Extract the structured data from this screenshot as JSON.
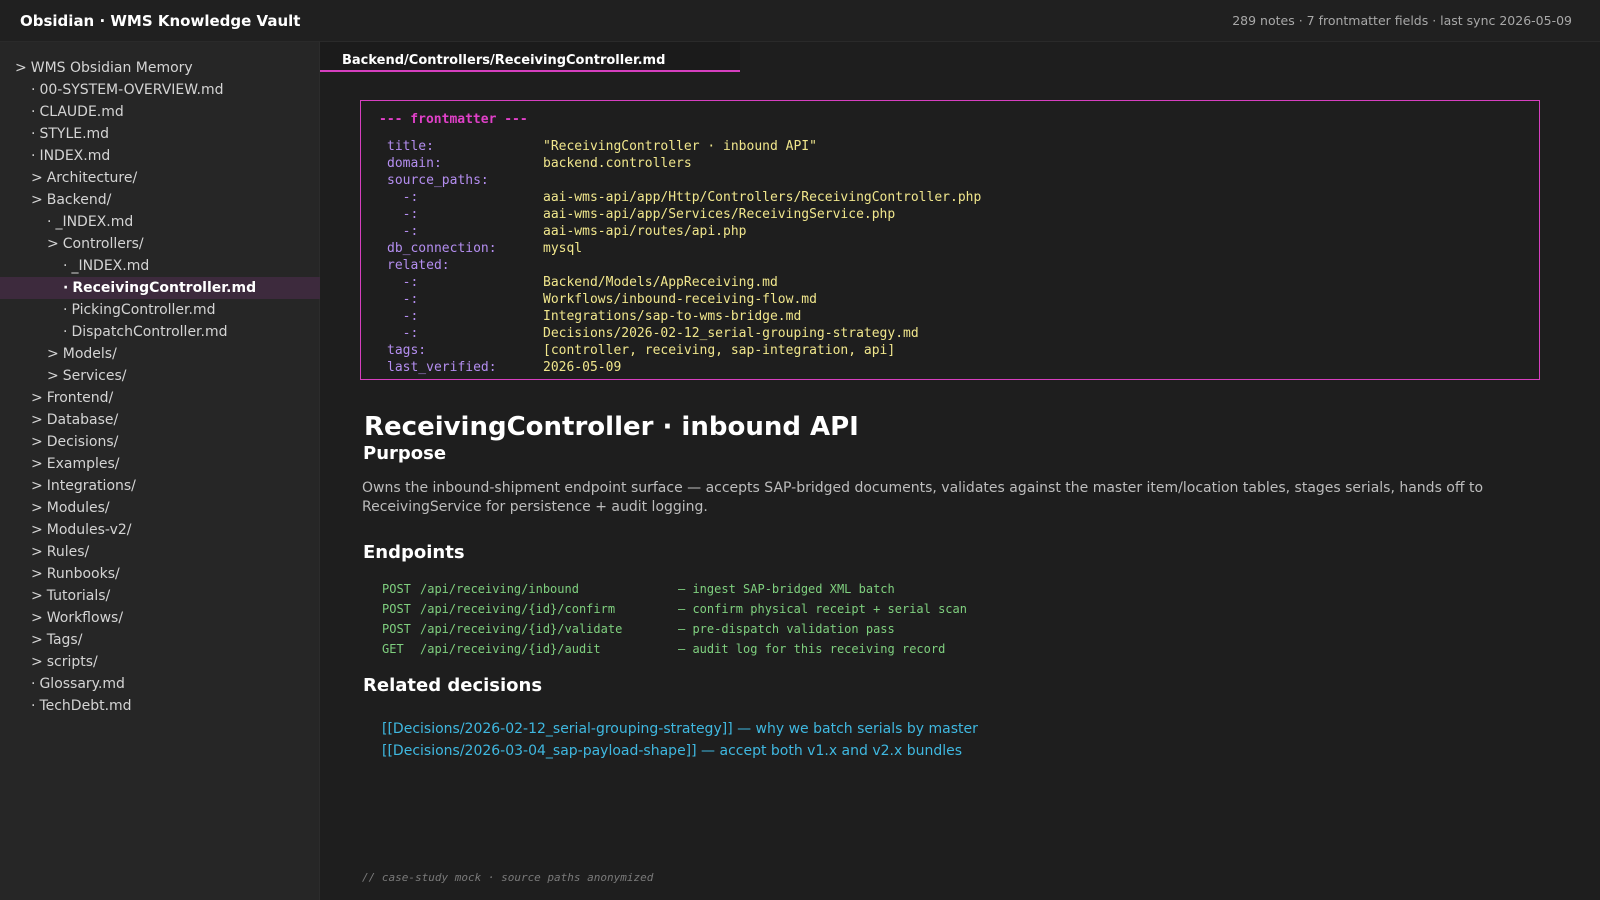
{
  "app": {
    "title": "Obsidian · WMS Knowledge Vault",
    "stats": "289 notes · 7 frontmatter fields · last sync 2026-05-09"
  },
  "sidebar": {
    "items": [
      {
        "label": "WMS Obsidian Memory",
        "marker": ">",
        "depth": 0,
        "type": "folder"
      },
      {
        "label": "00-SYSTEM-OVERVIEW.md",
        "marker": "·",
        "depth": 1,
        "type": "file"
      },
      {
        "label": "CLAUDE.md",
        "marker": "·",
        "depth": 1,
        "type": "file"
      },
      {
        "label": "STYLE.md",
        "marker": "·",
        "depth": 1,
        "type": "file"
      },
      {
        "label": "INDEX.md",
        "marker": "·",
        "depth": 1,
        "type": "file"
      },
      {
        "label": "Architecture/",
        "marker": ">",
        "depth": 1,
        "type": "folder"
      },
      {
        "label": "Backend/",
        "marker": ">",
        "depth": 1,
        "type": "folder"
      },
      {
        "label": "_INDEX.md",
        "marker": "·",
        "depth": 2,
        "type": "file"
      },
      {
        "label": "Controllers/",
        "marker": ">",
        "depth": 2,
        "type": "folder"
      },
      {
        "label": "_INDEX.md",
        "marker": "·",
        "depth": 3,
        "type": "file"
      },
      {
        "label": "ReceivingController.md",
        "marker": "·",
        "depth": 3,
        "type": "file",
        "active": true
      },
      {
        "label": "PickingController.md",
        "marker": "·",
        "depth": 3,
        "type": "file"
      },
      {
        "label": "DispatchController.md",
        "marker": "·",
        "depth": 3,
        "type": "file"
      },
      {
        "label": "Models/",
        "marker": ">",
        "depth": 2,
        "type": "folder"
      },
      {
        "label": "Services/",
        "marker": ">",
        "depth": 2,
        "type": "folder"
      },
      {
        "label": "Frontend/",
        "marker": ">",
        "depth": 1,
        "type": "folder"
      },
      {
        "label": "Database/",
        "marker": ">",
        "depth": 1,
        "type": "folder"
      },
      {
        "label": "Decisions/",
        "marker": ">",
        "depth": 1,
        "type": "folder"
      },
      {
        "label": "Examples/",
        "marker": ">",
        "depth": 1,
        "type": "folder"
      },
      {
        "label": "Integrations/",
        "marker": ">",
        "depth": 1,
        "type": "folder"
      },
      {
        "label": "Modules/",
        "marker": ">",
        "depth": 1,
        "type": "folder"
      },
      {
        "label": "Modules-v2/",
        "marker": ">",
        "depth": 1,
        "type": "folder"
      },
      {
        "label": "Rules/",
        "marker": ">",
        "depth": 1,
        "type": "folder"
      },
      {
        "label": "Runbooks/",
        "marker": ">",
        "depth": 1,
        "type": "folder"
      },
      {
        "label": "Tutorials/",
        "marker": ">",
        "depth": 1,
        "type": "folder"
      },
      {
        "label": "Workflows/",
        "marker": ">",
        "depth": 1,
        "type": "folder"
      },
      {
        "label": "Tags/",
        "marker": ">",
        "depth": 1,
        "type": "folder"
      },
      {
        "label": "scripts/",
        "marker": ">",
        "depth": 1,
        "type": "folder"
      },
      {
        "label": "Glossary.md",
        "marker": "·",
        "depth": 1,
        "type": "file"
      },
      {
        "label": "TechDebt.md",
        "marker": "·",
        "depth": 1,
        "type": "file"
      }
    ]
  },
  "tab": {
    "label": "Backend/Controllers/ReceivingController.md"
  },
  "frontmatter": {
    "header": "--- frontmatter ---",
    "lines": [
      {
        "key": "title:",
        "value": "\"ReceivingController · inbound API\""
      },
      {
        "key": "domain:",
        "value": "backend.controllers"
      },
      {
        "key": "source_paths:",
        "value": ""
      },
      {
        "key": "  -:",
        "value": "aai-wms-api/app/Http/Controllers/ReceivingController.php"
      },
      {
        "key": "  -:",
        "value": "aai-wms-api/app/Services/ReceivingService.php"
      },
      {
        "key": "  -:",
        "value": "aai-wms-api/routes/api.php"
      },
      {
        "key": "db_connection:",
        "value": "mysql"
      },
      {
        "key": "related:",
        "value": ""
      },
      {
        "key": "  -:",
        "value": "Backend/Models/AppReceiving.md"
      },
      {
        "key": "  -:",
        "value": "Workflows/inbound-receiving-flow.md"
      },
      {
        "key": "  -:",
        "value": "Integrations/sap-to-wms-bridge.md"
      },
      {
        "key": "  -:",
        "value": "Decisions/2026-02-12_serial-grouping-strategy.md"
      },
      {
        "key": "tags:",
        "value": "[controller, receiving, sap-integration, api]"
      },
      {
        "key": "last_verified:",
        "value": "2026-05-09"
      }
    ]
  },
  "doc": {
    "title": "ReceivingController · inbound API",
    "purpose_heading": "Purpose",
    "purpose_text": "Owns the inbound-shipment endpoint surface — accepts SAP-bridged documents, validates against the master item/location tables, stages serials, hands off to ReceivingService for persistence + audit logging.",
    "endpoints_heading": "Endpoints",
    "endpoints": [
      {
        "method": "POST",
        "path": "/api/receiving/inbound",
        "desc": "— ingest SAP-bridged XML batch"
      },
      {
        "method": "POST",
        "path": "/api/receiving/{id}/confirm",
        "desc": "— confirm physical receipt + serial scan"
      },
      {
        "method": "POST",
        "path": "/api/receiving/{id}/validate",
        "desc": "— pre-dispatch validation pass"
      },
      {
        "method": "GET",
        "path": "/api/receiving/{id}/audit",
        "desc": "— audit log for this receiving record"
      }
    ],
    "decisions_heading": "Related decisions",
    "decisions": [
      "[[Decisions/2026-02-12_serial-grouping-strategy]] — why we batch serials by master",
      "[[Decisions/2026-03-04_sap-payload-shape]] — accept both v1.x and v2.x bundles"
    ],
    "footer": "// case-study mock · source paths anonymized"
  }
}
